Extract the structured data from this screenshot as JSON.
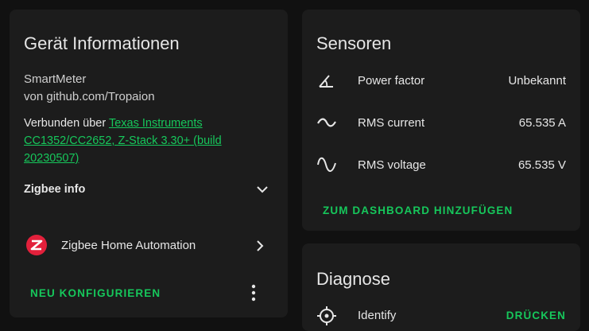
{
  "device": {
    "title": "Gerät Informationen",
    "model": "SmartMeter",
    "manufacturer_line": "von github.com/Tropaion",
    "connected_prefix": "Verbunden über ",
    "connected_link_line1": "Texas Instruments",
    "connected_link_line2": "CC1352/CC2652, Z-Stack 3.30+ (build",
    "connected_link_line3": "20230507)",
    "zigbee_info_label": "Zigbee info",
    "integration_label": "Zigbee Home Automation",
    "reconfigure_label": "NEU KONFIGURIEREN"
  },
  "sensors": {
    "title": "Sensoren",
    "rows": [
      {
        "icon": "angle-icon",
        "label": "Power factor",
        "value": "Unbekannt"
      },
      {
        "icon": "current-ac-icon",
        "label": "RMS current",
        "value": "65.535 A"
      },
      {
        "icon": "sine-wave-icon",
        "label": "RMS voltage",
        "value": "65.535 V"
      }
    ],
    "add_dashboard_label": "ZUM DASHBOARD HINZUFÜGEN"
  },
  "diagnostics": {
    "title": "Diagnose",
    "rows": [
      {
        "icon": "target-icon",
        "label": "Identify",
        "action": "DRÜCKEN"
      }
    ]
  },
  "colors": {
    "accent": "#16c75b",
    "card_bg": "#1c1c1c",
    "page_bg": "#111111",
    "zha_logo": "#e2203b"
  }
}
